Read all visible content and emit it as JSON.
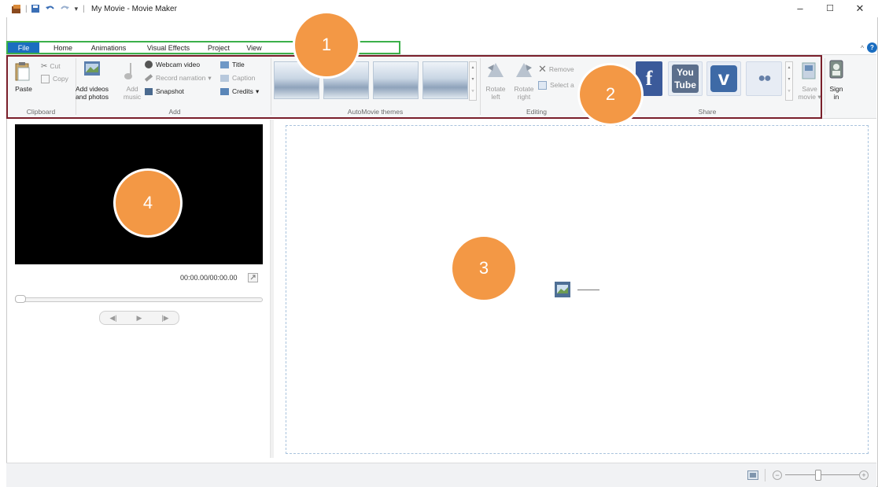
{
  "window": {
    "title": "My Movie - Movie Maker",
    "qat_separator": "|",
    "qat_dropdown": "▾",
    "minimize": "–",
    "maximize": "☐",
    "close": "✕",
    "collapse_ribbon": "^",
    "help": "?"
  },
  "tabs": [
    {
      "label": "File"
    },
    {
      "label": "Home"
    },
    {
      "label": "Animations"
    },
    {
      "label": "Visual Effects"
    },
    {
      "label": "Project"
    },
    {
      "label": "View"
    }
  ],
  "ribbon": {
    "clipboard": {
      "label": "Clipboard",
      "paste": "Paste",
      "cut": "Cut",
      "copy": "Copy"
    },
    "add": {
      "label": "Add",
      "add_videos": "Add videos",
      "add_videos_2": "and photos",
      "add_music": "Add",
      "add_music_2": "music",
      "webcam_video": "Webcam video",
      "record_narration": "Record narration",
      "snapshot": "Snapshot",
      "title": "Title",
      "caption": "Caption",
      "credits": "Credits"
    },
    "themes": {
      "label": "AutoMovie themes"
    },
    "editing": {
      "label": "Editing",
      "rotate_left": "Rotate",
      "rotate_left_2": "left",
      "rotate_right": "Rotate",
      "rotate_right_2": "right",
      "remove": "Remove",
      "select_all": "Select a"
    },
    "share": {
      "label": "Share",
      "facebook": "f",
      "youtube": "You",
      "youtube_2": "Tube",
      "vimeo": "v",
      "flickr": "●●",
      "save_movie": "Save",
      "save_movie_2": "movie"
    },
    "sign_in": "Sign",
    "sign_in_2": "in"
  },
  "preview": {
    "time": "00:00.00/00:00.00"
  },
  "callouts": [
    "1",
    "2",
    "3",
    "4"
  ],
  "colors": {
    "file_tab": "#1a6dc0",
    "callout": "#f39845",
    "tabs_highlight": "#3cb04a",
    "ribbon_highlight": "#7a1f2b"
  }
}
